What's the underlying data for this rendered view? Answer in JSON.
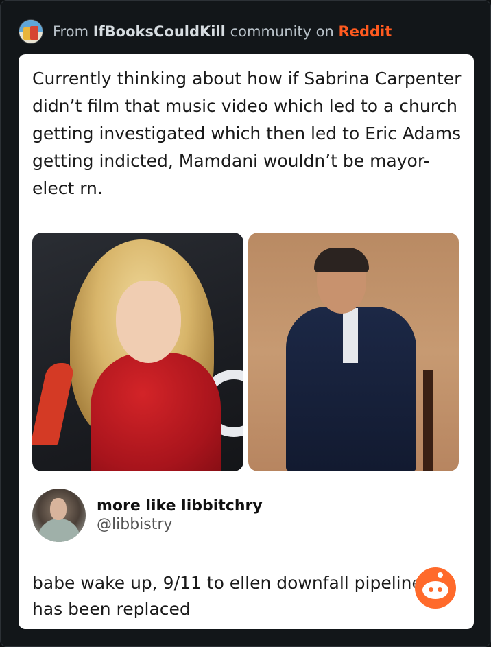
{
  "header": {
    "prefix": "From",
    "community": "IfBooksCouldKill",
    "middle": "community on",
    "platform": "Reddit",
    "platform_color": "#ff5a1f"
  },
  "post": {
    "text": "Currently thinking about how if Sabrina Carpenter didn’t film that music video which led to a church getting investigated which then led to Eric Adams getting indicted, Mamdani wouldn’t be mayor-elect rn."
  },
  "reply": {
    "author_name": "more like libbitchry",
    "author_handle": "@libbistry",
    "text": "babe wake up, 9/11 to ellen downfall pipeline has been replaced"
  },
  "icons": {
    "community_avatar": "community-avatar-icon",
    "reddit_badge": "reddit-snoo-icon"
  },
  "colors": {
    "page_background": "#0e1113",
    "card_background": "#ffffff",
    "reddit_orange": "#ff6a2b"
  }
}
